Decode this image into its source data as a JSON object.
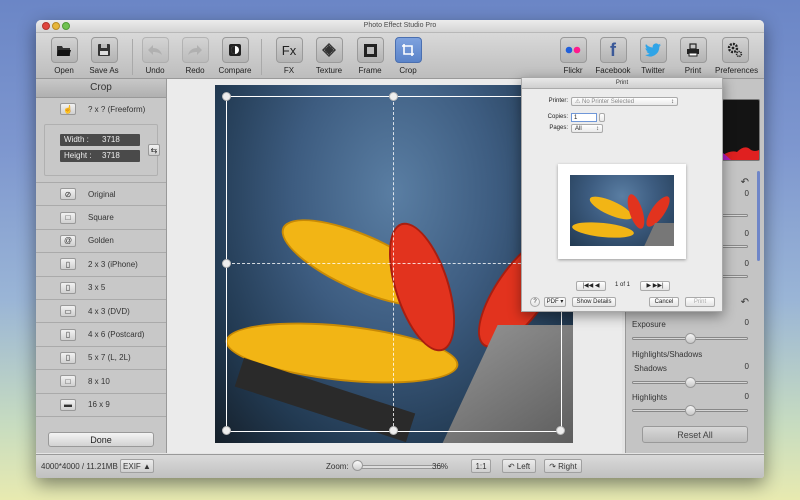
{
  "window": {
    "title": "Photo Effect Studio Pro"
  },
  "toolbar": {
    "open": "Open",
    "save_as": "Save As",
    "undo": "Undo",
    "redo": "Redo",
    "compare": "Compare",
    "fx": "FX",
    "fx_glyph": "Fx",
    "texture": "Texture",
    "frame": "Frame",
    "crop": "Crop",
    "flickr": "Flickr",
    "facebook": "Facebook",
    "facebook_glyph": "f",
    "twitter": "Twitter",
    "print": "Print",
    "preferences": "Preferences",
    "selected": "Crop"
  },
  "crop_panel": {
    "title": "Crop",
    "freeform_label": "? x ?  (Freeform)",
    "width_label": "Width :",
    "width_value": "3718",
    "height_label": "Height :",
    "height_value": "3718",
    "presets": [
      {
        "label": "Original",
        "icon": "circle-slash"
      },
      {
        "label": "Square",
        "icon": "square"
      },
      {
        "label": "Golden",
        "icon": "spiral"
      },
      {
        "label": "2 x 3  (iPhone)",
        "icon": "portrait-rect"
      },
      {
        "label": "3 x 5",
        "icon": "portrait-rect"
      },
      {
        "label": "4 x 3  (DVD)",
        "icon": "landscape-rect"
      },
      {
        "label": "4 x 6  (Postcard)",
        "icon": "portrait-rect"
      },
      {
        "label": "5 x 7  (L, 2L)",
        "icon": "portrait-rect"
      },
      {
        "label": "8 x 10",
        "icon": "portrait-rect"
      },
      {
        "label": "16 x 9",
        "icon": "wide-rect"
      }
    ],
    "done_label": "Done"
  },
  "adjust_panel": {
    "values_top": [
      "0",
      "0",
      "0"
    ],
    "exposure_label": "Exposure",
    "exposure_value": "0",
    "highlights_shadows_label": "Highlights/Shadows",
    "shadows_label": "Shadows",
    "shadows_value": "0",
    "highlights_label": "Highlights",
    "highlights_value": "0",
    "slider_positions": [
      0.5,
      0.5,
      0.5
    ],
    "reset_all_label": "Reset All"
  },
  "status_bar": {
    "image_info": "4000*4000 / 11.21MB",
    "exif_label": "EXIF ▲",
    "zoom_label": "Zoom:",
    "zoom_value": "36%",
    "zoom_fraction": 0.0,
    "one_to_one": "1:1",
    "rotate_left": "Left",
    "rotate_right": "Right"
  },
  "print_dialog": {
    "title": "Print",
    "printer_label": "Printer:",
    "printer_value": "⚠ No Printer Selected",
    "copies_label": "Copies:",
    "copies_value": "1",
    "pages_label": "Pages:",
    "pages_value": "All",
    "page_indicator": "1 of 1",
    "help": "?",
    "pdf_label": "PDF ▾",
    "show_details": "Show Details",
    "cancel": "Cancel",
    "print": "Print"
  }
}
